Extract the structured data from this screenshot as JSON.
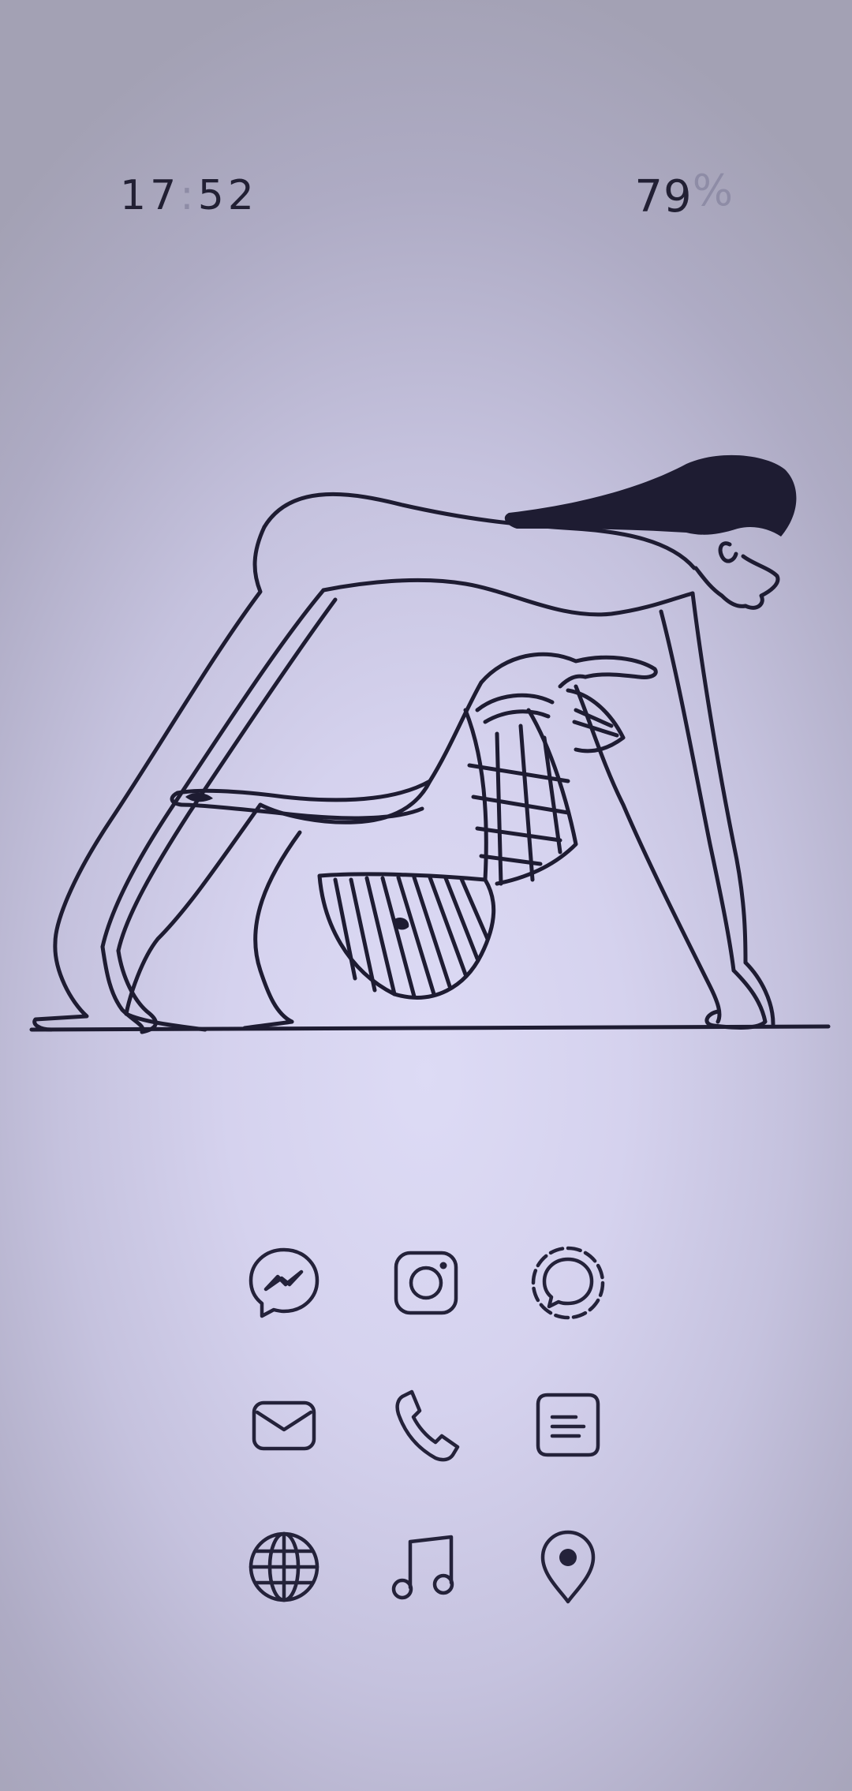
{
  "status_bar": {
    "time_hours": "17",
    "time_separator": ":",
    "time_minutes": "52",
    "battery_value": "79",
    "battery_unit": "%"
  },
  "home": {
    "wallpaper": "egyptian-acrobatic-dancer-line-art",
    "colors": {
      "background_center": "#dddbf5",
      "background_edge": "#a3a1b4",
      "ink": "#1e1c32",
      "muted": "#8e8ca6"
    },
    "apps": [
      {
        "icon": "messenger-icon"
      },
      {
        "icon": "instagram-icon"
      },
      {
        "icon": "signal-icon"
      },
      {
        "icon": "mail-icon"
      },
      {
        "icon": "phone-icon"
      },
      {
        "icon": "notes-icon"
      },
      {
        "icon": "browser-globe-icon"
      },
      {
        "icon": "music-icon"
      },
      {
        "icon": "maps-pin-icon"
      }
    ]
  }
}
